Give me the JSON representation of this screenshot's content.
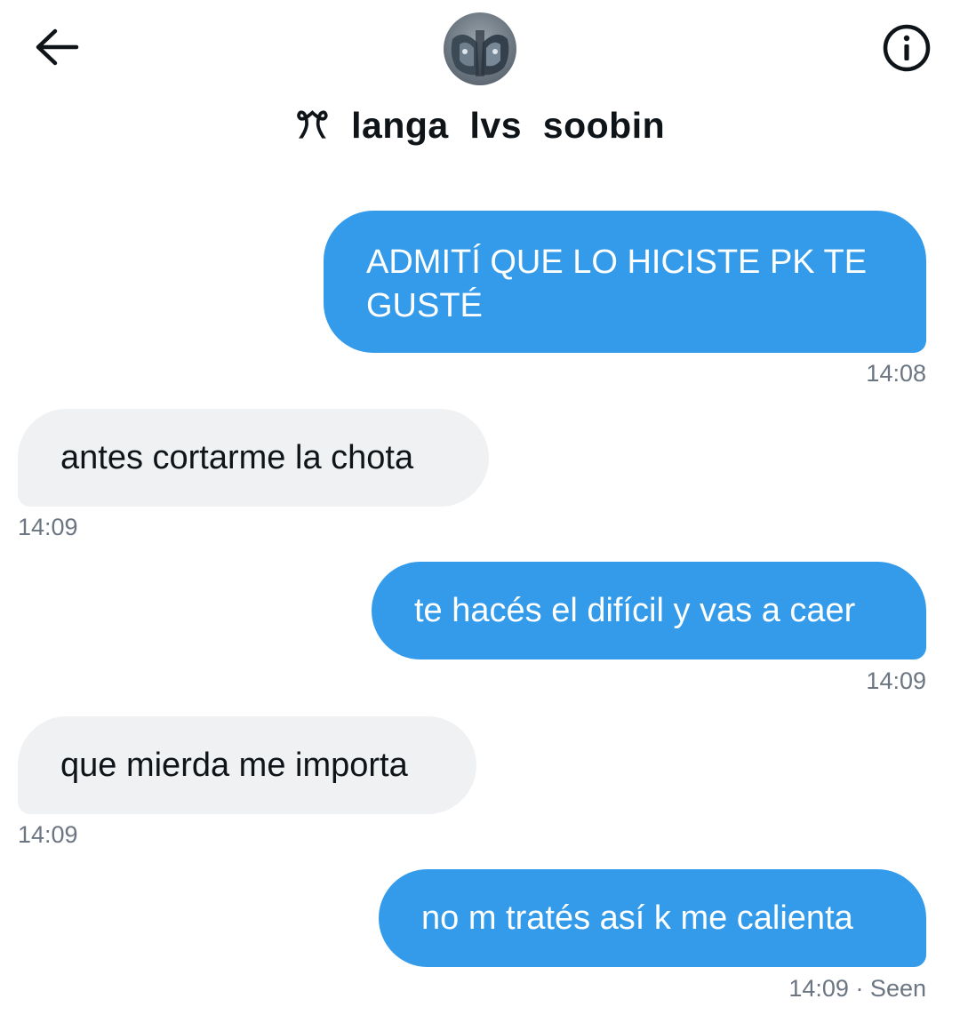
{
  "header": {
    "title": "ꔫ  langa  lvs  soobin",
    "back_label": "Back",
    "info_label": "Conversation info"
  },
  "messages": [
    {
      "direction": "sent",
      "text": "ADMITÍ QUE LO HICISTE PK TE GUSTÉ",
      "time": "14:08"
    },
    {
      "direction": "received",
      "text": "antes cortarme la chota",
      "time": "14:09"
    },
    {
      "direction": "sent",
      "text": "te hacés el difícil y vas a caer",
      "time": "14:09"
    },
    {
      "direction": "received",
      "text": "que mierda me importa",
      "time": "14:09"
    },
    {
      "direction": "sent",
      "text": "no m tratés así k me calienta",
      "time": "14:09 · Seen"
    }
  ],
  "colors": {
    "sent_bubble": "#349bea",
    "received_bubble": "#eff1f3",
    "timestamp": "#6b7682"
  },
  "icons": {
    "back": "arrow-left-icon",
    "info": "info-circle-icon"
  }
}
